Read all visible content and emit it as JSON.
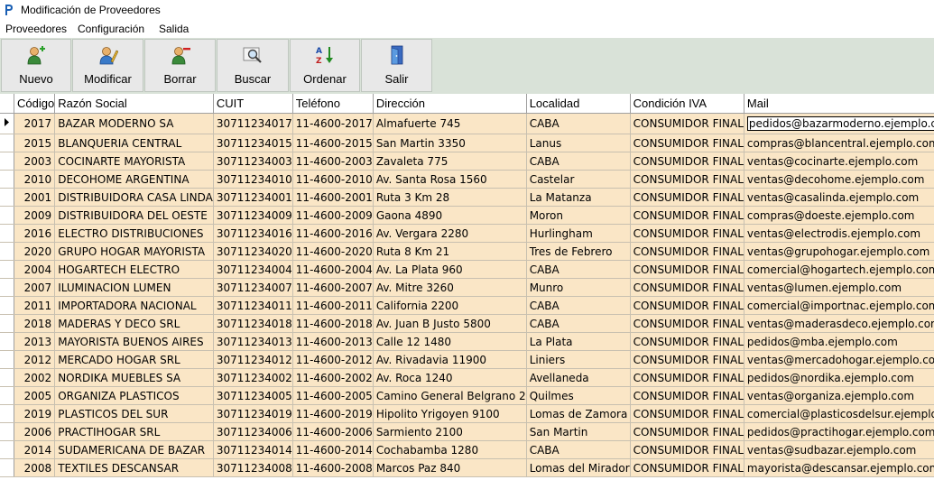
{
  "window": {
    "title": "Modificación de Proveedores"
  },
  "menu": [
    "Proveedores",
    "Configuración",
    "Salida"
  ],
  "toolbar": [
    {
      "label": "Nuevo",
      "icon": "add-user-icon"
    },
    {
      "label": "Modificar",
      "icon": "edit-user-icon"
    },
    {
      "label": "Borrar",
      "icon": "remove-user-icon"
    },
    {
      "label": "Buscar",
      "icon": "search-icon"
    },
    {
      "label": "Ordenar",
      "icon": "sort-az-icon"
    },
    {
      "label": "Salir",
      "icon": "exit-door-icon"
    }
  ],
  "grid": {
    "columns": [
      "Código",
      "Razón Social",
      "CUIT",
      "Teléfono",
      "Dirección",
      "Localidad",
      "Condición IVA",
      "Mail"
    ],
    "rows": [
      [
        "2017",
        "BAZAR MODERNO SA",
        "30711234017",
        "11-4600-2017",
        "Almafuerte 745",
        "CABA",
        "CONSUMIDOR FINAL",
        "pedidos@bazarmoderno.ejemplo.com"
      ],
      [
        "2015",
        "BLANQUERIA CENTRAL",
        "30711234015",
        "11-4600-2015",
        "San Martin 3350",
        "Lanus",
        "CONSUMIDOR FINAL",
        "compras@blancentral.ejemplo.com"
      ],
      [
        "2003",
        "COCINARTE MAYORISTA",
        "30711234003",
        "11-4600-2003",
        "Zavaleta 775",
        "CABA",
        "CONSUMIDOR FINAL",
        "ventas@cocinarte.ejemplo.com"
      ],
      [
        "2010",
        "DECOHOME ARGENTINA",
        "30711234010",
        "11-4600-2010",
        "Av. Santa Rosa 1560",
        "Castelar",
        "CONSUMIDOR FINAL",
        "ventas@decohome.ejemplo.com"
      ],
      [
        "2001",
        "DISTRIBUIDORA CASA LINDA",
        "30711234001",
        "11-4600-2001",
        "Ruta 3 Km 28",
        "La Matanza",
        "CONSUMIDOR FINAL",
        "ventas@casalinda.ejemplo.com"
      ],
      [
        "2009",
        "DISTRIBUIDORA DEL OESTE",
        "30711234009",
        "11-4600-2009",
        "Gaona 4890",
        "Moron",
        "CONSUMIDOR FINAL",
        "compras@doeste.ejemplo.com"
      ],
      [
        "2016",
        "ELECTRO DISTRIBUCIONES",
        "30711234016",
        "11-4600-2016",
        "Av. Vergara 2280",
        "Hurlingham",
        "CONSUMIDOR FINAL",
        "ventas@electrodis.ejemplo.com"
      ],
      [
        "2020",
        "GRUPO HOGAR MAYORISTA",
        "30711234020",
        "11-4600-2020",
        "Ruta 8 Km 21",
        "Tres de Febrero",
        "CONSUMIDOR FINAL",
        "ventas@grupohogar.ejemplo.com"
      ],
      [
        "2004",
        "HOGARTECH ELECTRO",
        "30711234004",
        "11-4600-2004",
        "Av. La Plata 960",
        "CABA",
        "CONSUMIDOR FINAL",
        "comercial@hogartech.ejemplo.com"
      ],
      [
        "2007",
        "ILUMINACION LUMEN",
        "30711234007",
        "11-4600-2007",
        "Av. Mitre 3260",
        "Munro",
        "CONSUMIDOR FINAL",
        "ventas@lumen.ejemplo.com"
      ],
      [
        "2011",
        "IMPORTADORA NACIONAL",
        "30711234011",
        "11-4600-2011",
        "California 2200",
        "CABA",
        "CONSUMIDOR FINAL",
        "comercial@importnac.ejemplo.com"
      ],
      [
        "2018",
        "MADERAS Y DECO SRL",
        "30711234018",
        "11-4600-2018",
        "Av. Juan B Justo 5800",
        "CABA",
        "CONSUMIDOR FINAL",
        "ventas@maderasdeco.ejemplo.com"
      ],
      [
        "2013",
        "MAYORISTA BUENOS AIRES",
        "30711234013",
        "11-4600-2013",
        "Calle 12 1480",
        "La Plata",
        "CONSUMIDOR FINAL",
        "pedidos@mba.ejemplo.com"
      ],
      [
        "2012",
        "MERCADO HOGAR SRL",
        "30711234012",
        "11-4600-2012",
        "Av. Rivadavia 11900",
        "Liniers",
        "CONSUMIDOR FINAL",
        "ventas@mercadohogar.ejemplo.com"
      ],
      [
        "2002",
        "NORDIKA MUEBLES SA",
        "30711234002",
        "11-4600-2002",
        "Av. Roca 1240",
        "Avellaneda",
        "CONSUMIDOR FINAL",
        "pedidos@nordika.ejemplo.com"
      ],
      [
        "2005",
        "ORGANIZA PLASTICOS",
        "30711234005",
        "11-4600-2005",
        "Camino General Belgrano 2",
        "Quilmes",
        "CONSUMIDOR FINAL",
        "ventas@organiza.ejemplo.com"
      ],
      [
        "2019",
        "PLASTICOS DEL SUR",
        "30711234019",
        "11-4600-2019",
        "Hipolito Yrigoyen 9100",
        "Lomas de Zamora",
        "CONSUMIDOR FINAL",
        "comercial@plasticosdelsur.ejemplo.com"
      ],
      [
        "2006",
        "PRACTIHOGAR SRL",
        "30711234006",
        "11-4600-2006",
        "Sarmiento 2100",
        "San Martin",
        "CONSUMIDOR FINAL",
        "pedidos@practihogar.ejemplo.com"
      ],
      [
        "2014",
        "SUDAMERICANA DE BAZAR",
        "30711234014",
        "11-4600-2014",
        "Cochabamba 1280",
        "CABA",
        "CONSUMIDOR FINAL",
        "ventas@sudbazar.ejemplo.com"
      ],
      [
        "2008",
        "TEXTILES DESCANSAR",
        "30711234008",
        "11-4600-2008",
        "Marcos Paz 840",
        "Lomas del Mirador",
        "CONSUMIDOR FINAL",
        "mayorista@descansar.ejemplo.com"
      ]
    ]
  }
}
